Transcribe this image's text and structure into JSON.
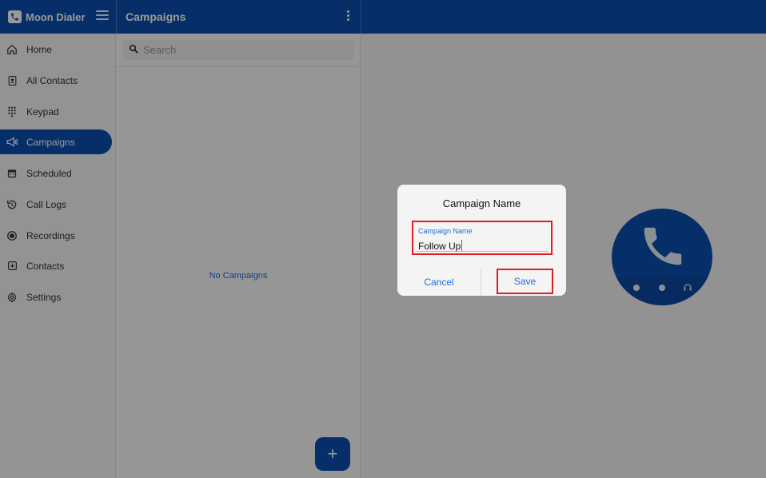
{
  "app": {
    "name": "Moon Dialer"
  },
  "header": {
    "section_title": "Campaigns"
  },
  "sidebar": {
    "items": [
      {
        "label": "Home",
        "icon": "home-icon"
      },
      {
        "label": "All Contacts",
        "icon": "contacts-book-icon"
      },
      {
        "label": "Keypad",
        "icon": "keypad-icon"
      },
      {
        "label": "Campaigns",
        "icon": "megaphone-icon",
        "active": true
      },
      {
        "label": "Scheduled",
        "icon": "calendar-icon"
      },
      {
        "label": "Call Logs",
        "icon": "history-icon"
      },
      {
        "label": "Recordings",
        "icon": "record-icon"
      },
      {
        "label": "Contacts",
        "icon": "import-contacts-icon"
      },
      {
        "label": "Settings",
        "icon": "gear-icon"
      }
    ]
  },
  "campaigns_panel": {
    "search_placeholder": "Search",
    "empty_text": "No Campaigns",
    "fab_label": "+"
  },
  "dialog": {
    "title": "Campaign Name",
    "field_label": "Campaign Name",
    "field_value": "Follow Up",
    "cancel_label": "Cancel",
    "save_label": "Save"
  },
  "colors": {
    "primary": "#0a4fb0",
    "link": "#1d6fd6",
    "highlight": "#e31b23"
  }
}
